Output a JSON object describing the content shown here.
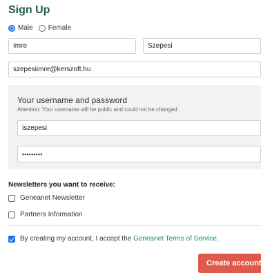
{
  "form": {
    "title": "Sign Up",
    "gender": {
      "options": [
        "Male",
        "Female"
      ],
      "selected": "Male"
    },
    "first_name": "Imre",
    "last_name": "Szepesi",
    "email": "szepesiimre@kerszoft.hu"
  },
  "credentials": {
    "heading": "Your username and password",
    "note": "Attention: Your username will be public and could not be changed",
    "username": "iszepesi",
    "password_mask": "•••••••••"
  },
  "newsletters": {
    "heading": "Newsletters you want to receive:",
    "items": [
      {
        "label": "Geneanet Newsletter",
        "checked": false
      },
      {
        "label": "Partners Information",
        "checked": false
      }
    ]
  },
  "terms": {
    "checked": true,
    "prefix": "By creating my account, I accept the ",
    "link_text": "Geneanet Terms of Service",
    "suffix": "."
  },
  "submit_label": "Create account"
}
